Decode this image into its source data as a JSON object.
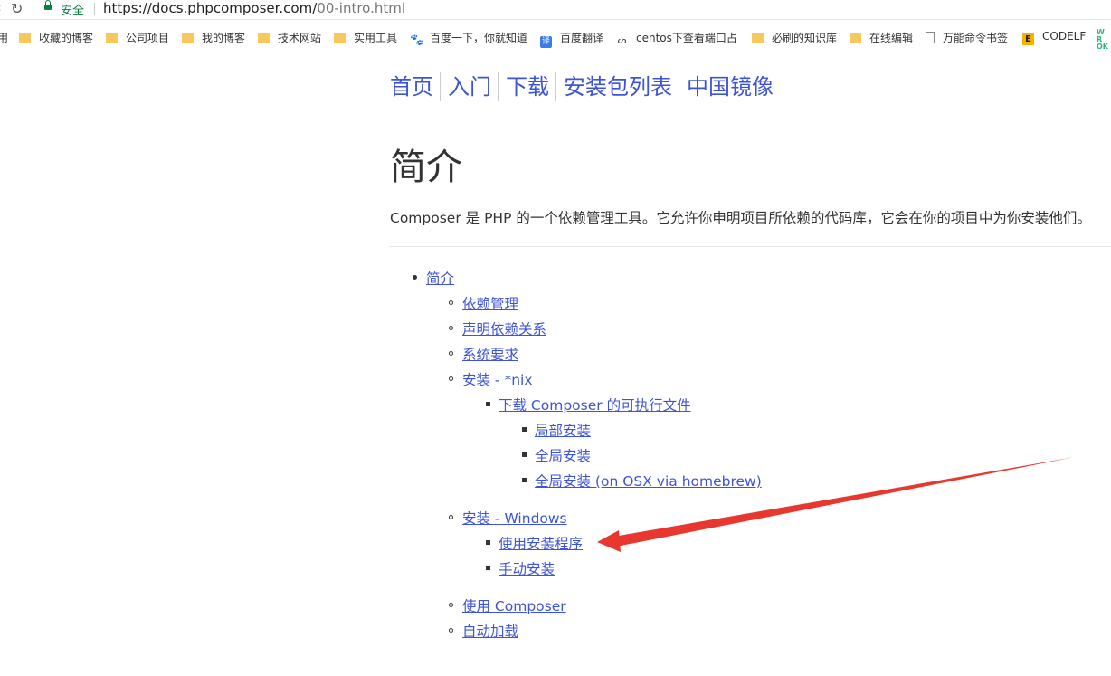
{
  "browser": {
    "secure_label": "安全",
    "url_host": "https://docs.phpcomposer.com/",
    "url_path": "00-intro.html"
  },
  "bookmarks": [
    {
      "label": "用",
      "icon": "none"
    },
    {
      "label": "收藏的博客",
      "icon": "folder-icon"
    },
    {
      "label": "公司项目",
      "icon": "folder-icon"
    },
    {
      "label": "我的博客",
      "icon": "folder-icon"
    },
    {
      "label": "技术网站",
      "icon": "folder-icon"
    },
    {
      "label": "实用工具",
      "icon": "folder-icon"
    },
    {
      "label": "百度一下，你就知道",
      "icon": "baidu-paw-icon"
    },
    {
      "label": "百度翻译",
      "icon": "translate-icon"
    },
    {
      "label": "centos下查看端口占",
      "icon": "centos-icon"
    },
    {
      "label": "必刷的知识库",
      "icon": "folder-icon"
    },
    {
      "label": "在线编辑",
      "icon": "folder-icon"
    },
    {
      "label": "万能命令书签",
      "icon": "document-icon"
    },
    {
      "label": "CODELF",
      "icon": "codelf-icon"
    }
  ],
  "bookmark_extra": "WR OK",
  "nav": [
    "首页",
    "入门",
    "下载",
    "安装包列表",
    "中国镜像"
  ],
  "page": {
    "title": "简介",
    "intro": "Composer 是 PHP 的一个依赖管理工具。它允许你申明项目所依赖的代码库，它会在你的项目中为你安装他们。"
  },
  "toc": {
    "root": "简介",
    "dep_mgmt": "依赖管理",
    "declare": "声明依赖关系",
    "sysreq": "系统要求",
    "install_nix": "安装 - *nix",
    "download_exec": "下载 Composer 的可执行文件",
    "local_install": "局部安装",
    "global_install": "全局安装",
    "global_osx": "全局安装 (on OSX via homebrew)",
    "install_win": "安装 - Windows",
    "use_installer": "使用安装程序",
    "manual_install": "手动安装",
    "use_composer": "使用 Composer",
    "autoload": "自动加载"
  },
  "colors": {
    "link": "#3e54d8",
    "annotation_arrow": "#e8372f",
    "secure": "#0b8043"
  }
}
